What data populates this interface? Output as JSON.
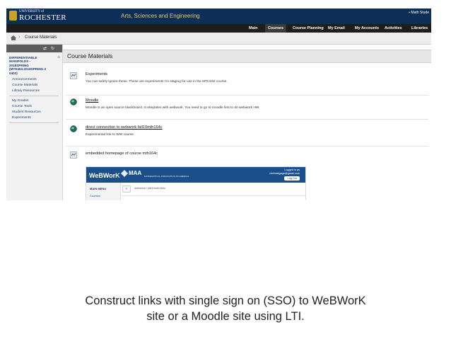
{
  "header": {
    "university_small": "UNIVERSITY of",
    "university_name": "ROCHESTER",
    "department": "Arts, Sciences and Engineering",
    "user_name": "Math Stude"
  },
  "nav": {
    "tabs": [
      {
        "label": "Main"
      },
      {
        "label": "Courses",
        "active": true
      },
      {
        "label": "Course Planning"
      },
      {
        "label": "My Email"
      },
      {
        "label": "My Accounts"
      },
      {
        "label": "Activities"
      },
      {
        "label": "Libraries"
      }
    ]
  },
  "breadcrumb": {
    "current": "Course Materials"
  },
  "sidebar": {
    "course_lines": [
      "DIFFERENTIABLE",
      "MANIFOLDS -",
      "2018SPRING",
      "(MTH453.2018SPRING.3",
      "0403)"
    ],
    "group1": [
      "Announcements",
      "Course Materials",
      "Library Resources"
    ],
    "group2": [
      "My Grades",
      "Course Tools",
      "Student Resources",
      "Experiments"
    ]
  },
  "main": {
    "page_title": "Course Materials",
    "items": [
      {
        "title": "Experiments",
        "desc": "You can safely ignore these.  These are experiments I'm staging for use in the MTH162 course.",
        "link": false,
        "icon": "folder-icon"
      },
      {
        "title": "Moodle",
        "desc": "Moodle is an open source blackboard. It integrates with webwork. You need to go to moodle first to do webwork HW.",
        "link": true,
        "icon": "globe-icon"
      },
      {
        "title": "direct connection to webwork fall10mth164c",
        "desc": "Experimental link to WW course",
        "link": true,
        "icon": "globe-icon"
      },
      {
        "title": "embedded homepage of course mth164c",
        "desc": "",
        "link": false,
        "icon": "folder-icon"
      }
    ]
  },
  "webwork": {
    "logo": "WeBWorK",
    "maa": "MAA",
    "maa_sub": "MATHEMATICAL ASSOCIATION OF AMERICA",
    "logged_in": "Logged in as",
    "email": "michaelgage@gmail.com",
    "logout": "Log Out",
    "main_menu": "MAIN MENU",
    "courses": "Courses",
    "back": "‹",
    "crumb": "webwork / fall10mth164c"
  },
  "caption": {
    "line1": "Construct links with single sign on (SSO) to WeBWorK",
    "line2": "site or a Moodle site using LTI."
  },
  "colors": {
    "topbar": "#0c2e57",
    "navbar": "#1d1d1d",
    "department_text": "#e6c873",
    "webwork_bar": "#1a4f8c"
  }
}
